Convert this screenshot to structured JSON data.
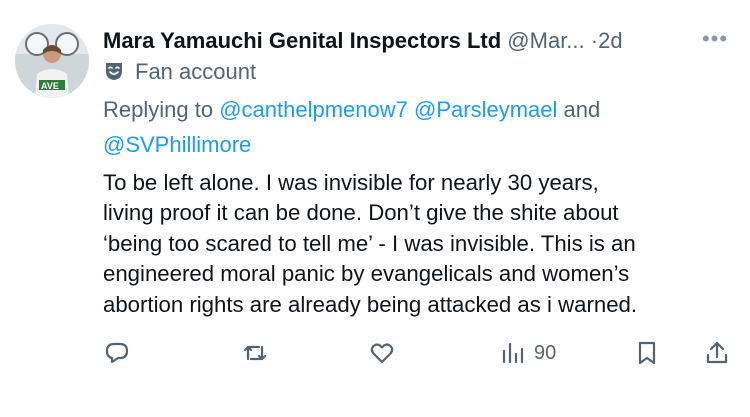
{
  "tweet": {
    "display_name": "Mara Yamauchi Genital Inspectors Ltd",
    "handle": "@Mar...",
    "separator": "·",
    "timestamp": "2d",
    "more_icon": "more-horizontal-icon",
    "label_icon": "theater-mask-icon",
    "label": "Fan account",
    "replying_prefix": "Replying to",
    "replying_to": [
      "@canthelpmenow7",
      "@Parsleymael",
      "@SVPhillimore"
    ],
    "replying_and": "and",
    "body_lines": [
      "To be left alone.  I was invisible for nearly 30 years,",
      "living proof it can be done.  Don’t give the shite about",
      "‘being too scared to tell me’ - I was invisible.  This is an",
      "engineered moral panic by evangelicals and women’s",
      "abortion rights are already being attacked as i warned."
    ]
  },
  "actions": {
    "reply_icon": "reply-bubble-icon",
    "retweet_icon": "retweet-icon",
    "like_icon": "heart-icon",
    "views_icon": "views-bar-chart-icon",
    "views_count": "90",
    "bookmark_icon": "bookmark-icon",
    "share_icon": "share-upload-icon"
  },
  "colors": {
    "text": "#0f1419",
    "secondary": "#536471",
    "link": "#1d9bf0",
    "background": "#ffffff"
  }
}
